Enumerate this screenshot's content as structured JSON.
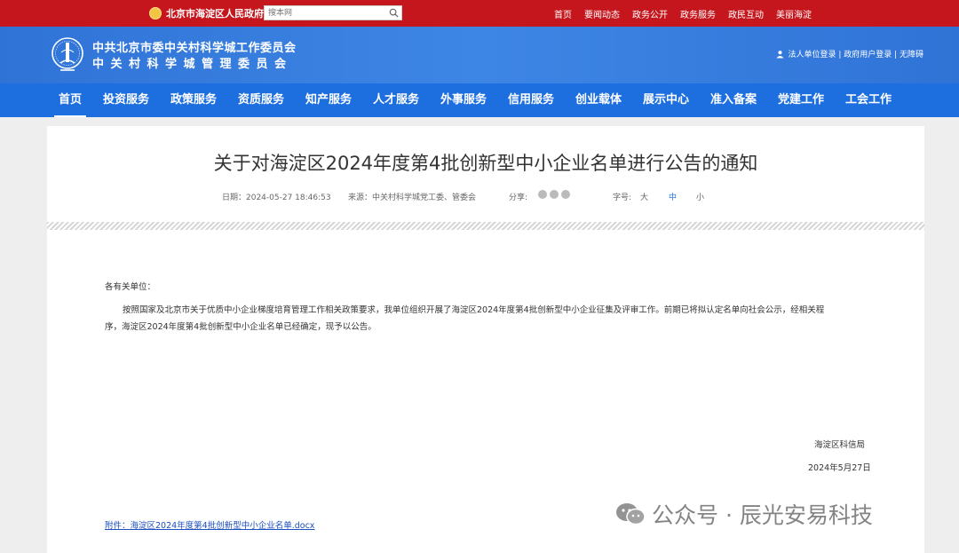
{
  "topbar": {
    "gov_title": "北京市海淀区人民政府",
    "search_placeholder": "搜本网",
    "links": [
      "首页",
      "要闻动态",
      "政务公开",
      "政务服务",
      "政民互动",
      "美丽海淀"
    ]
  },
  "header": {
    "org_line1": "中共北京市委中关村科学城工作委员会",
    "org_line2": "中关村科学城管理委员会",
    "user_links": "法人单位登录 | 政府用户登录 | 无障碍"
  },
  "nav": {
    "items": [
      "首页",
      "投资服务",
      "政策服务",
      "资质服务",
      "知产服务",
      "人才服务",
      "外事服务",
      "信用服务",
      "创业载体",
      "展示中心",
      "准入备案",
      "党建工作",
      "工会工作"
    ]
  },
  "article": {
    "title": "关于对海淀区2024年度第4批创新型中小企业名单进行公告的通知",
    "date": "日期：2024-05-27 18:46:53",
    "source": "来源：中关村科学城党工委、管委会",
    "share_label": "分享:",
    "font_label": "字号:",
    "font_large": "大",
    "font_medium": "中",
    "font_small": "小",
    "salutation": "各有关单位：",
    "para_line1": "按照国家及北京市关于优质中小企业梯度培育管理工作相关政策要求，我单位组织开展了海淀区2024年度第4批创新型中小企业征集及评审工作。前期已将拟认定名单向社会公示，经相关程",
    "para_line2": "序，海淀区2024年度第4批创新型中小企业名单已经确定，现予以公告。",
    "signer": "海淀区科信局",
    "sign_date": "2024年5月27日",
    "attachment": "附件：海淀区2024年度第4批创新型中小企业名单.docx"
  },
  "watermark": {
    "text": "公众号 · 辰光安易科技"
  },
  "colors": {
    "topbar": "#c4161c",
    "header": "#3e86e5",
    "nav": "#1d6fe0",
    "link": "#1d4fbf",
    "font_active": "#1d6fe0"
  }
}
